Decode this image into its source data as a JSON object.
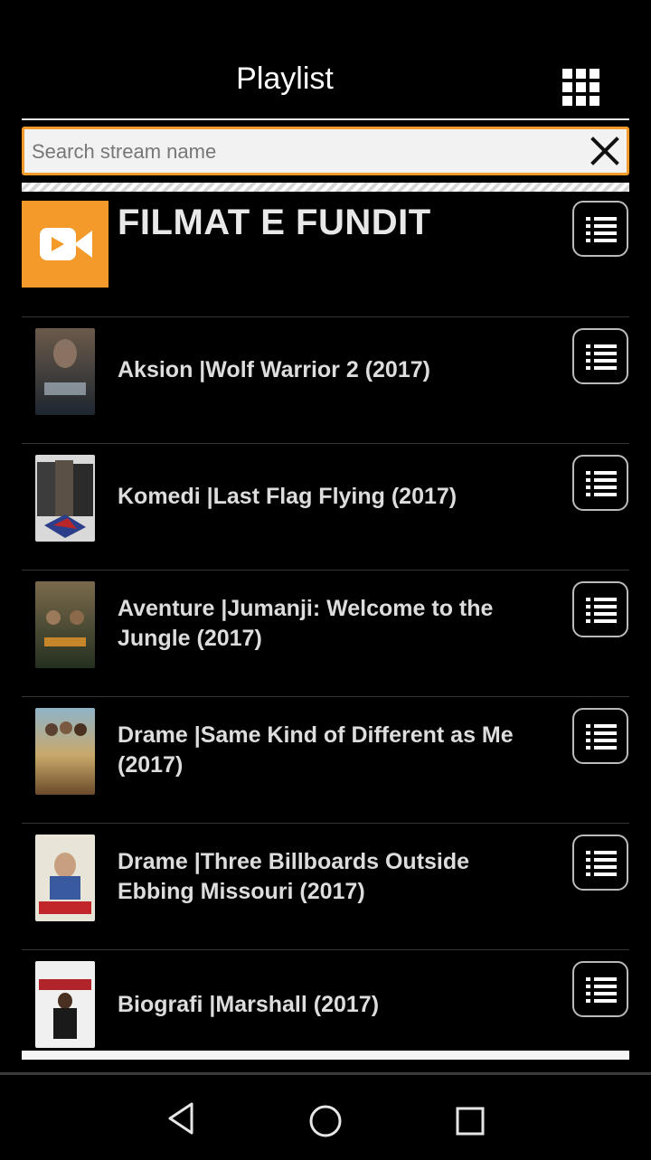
{
  "header": {
    "title": "Playlist",
    "grid_icon": "grid-view-icon"
  },
  "search": {
    "placeholder": "Search stream name",
    "value": "",
    "clear_icon": "close-icon"
  },
  "playlist": {
    "items": [
      {
        "label": "FILMAT E FUNDIT",
        "thumb": "video-camera-logo",
        "menu_icon": "list-menu-icon"
      },
      {
        "label": "Aksion |Wolf Warrior 2 (2017)",
        "thumb": "poster",
        "menu_icon": "list-menu-icon"
      },
      {
        "label": "Komedi |Last Flag Flying (2017)",
        "thumb": "poster",
        "menu_icon": "list-menu-icon"
      },
      {
        "label": "Aventure |Jumanji: Welcome to the Jungle (2017)",
        "thumb": "poster",
        "menu_icon": "list-menu-icon"
      },
      {
        "label": "Drame |Same Kind of Different as Me (2017)",
        "thumb": "poster",
        "menu_icon": "list-menu-icon"
      },
      {
        "label": "Drame |Three Billboards Outside Ebbing Missouri (2017)",
        "thumb": "poster",
        "menu_icon": "list-menu-icon"
      },
      {
        "label": "Biografi |Marshall (2017)",
        "thumb": "poster",
        "menu_icon": "list-menu-icon"
      }
    ]
  },
  "nav": {
    "back_icon": "back-triangle-icon",
    "home_icon": "home-circle-icon",
    "recents_icon": "recents-square-icon"
  },
  "colors": {
    "accent": "#f39a2a",
    "background": "#000000",
    "text": "#dddddd"
  }
}
